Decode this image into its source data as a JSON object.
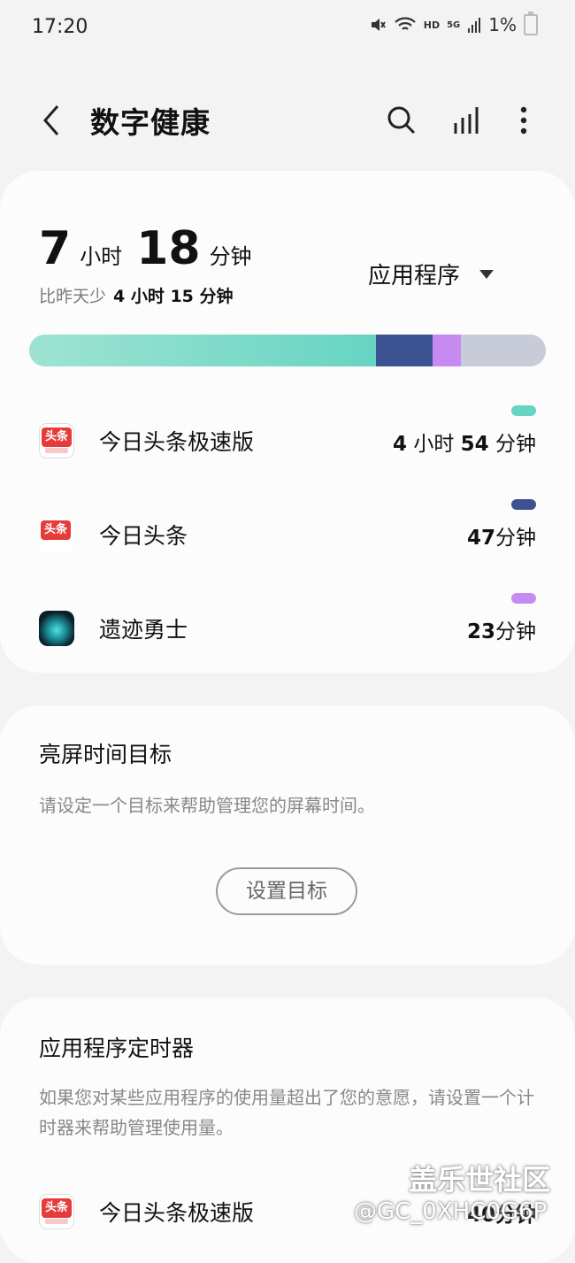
{
  "status_bar": {
    "time": "17:20",
    "network": "HD",
    "signal": "5G",
    "battery": "1%"
  },
  "appbar": {
    "title": "数字健康"
  },
  "usage": {
    "hours": "7",
    "hours_unit": "小时",
    "minutes": "18",
    "minutes_unit": "分钟",
    "compare_prefix": "比昨天少",
    "compare_value": "4 小时 15 分钟",
    "filter_label": "应用程序",
    "bar_fractions": [
      0.671,
      0.11,
      0.055,
      0.164
    ],
    "apps": [
      {
        "name": "今日头条极速版",
        "time_num1": "4",
        "time_unit1": " 小时 ",
        "time_num2": "54",
        "time_unit2": " 分钟",
        "color": "#67d4c3",
        "icon": "toutiao-lite-icon"
      },
      {
        "name": "今日头条",
        "time_num1": "",
        "time_unit1": "",
        "time_num2": "47",
        "time_unit2": "分钟",
        "color": "#3d5290",
        "icon": "toutiao-icon"
      },
      {
        "name": "遗迹勇士",
        "time_num1": "",
        "time_unit1": "",
        "time_num2": "23",
        "time_unit2": "分钟",
        "color": "#c68af0",
        "icon": "game-icon"
      }
    ]
  },
  "goal": {
    "title": "亮屏时间目标",
    "description": "请设定一个目标来帮助管理您的屏幕时间。",
    "button": "设置目标"
  },
  "timer": {
    "title": "应用程序定时器",
    "description": "如果您对某些应用程序的使用量超出了您的意愿，请设置一个计时器来帮助管理使用量。",
    "app_name": "今日头条极速版",
    "app_time": "40分钟"
  },
  "watermark": {
    "line1": "盖乐世社区",
    "line2": "@GC_0XHC0G6P"
  }
}
